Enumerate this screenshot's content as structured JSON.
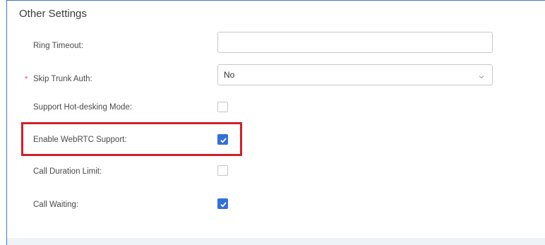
{
  "section": {
    "title": "Other Settings"
  },
  "fields": {
    "ring_timeout": {
      "label": "Ring Timeout:",
      "value": "",
      "placeholder": ""
    },
    "skip_trunk_auth": {
      "required_marker": "*",
      "label": "Skip Trunk Auth:",
      "selected": "No"
    },
    "hot_desking": {
      "label": "Support Hot-desking Mode:",
      "checked": false
    },
    "webrtc": {
      "label": "Enable WebRTC Support:",
      "checked": true
    },
    "call_duration_limit": {
      "label": "Call Duration Limit:",
      "checked": false
    },
    "call_waiting": {
      "label": "Call Waiting:",
      "checked": true
    }
  },
  "colors": {
    "accent": "#3370d9",
    "highlight": "#d0202a",
    "required": "#e04a4a",
    "panel_border": "#3b7bc4"
  },
  "icons": {
    "select_arrow": "chevron-down-icon",
    "check": "check-icon"
  }
}
